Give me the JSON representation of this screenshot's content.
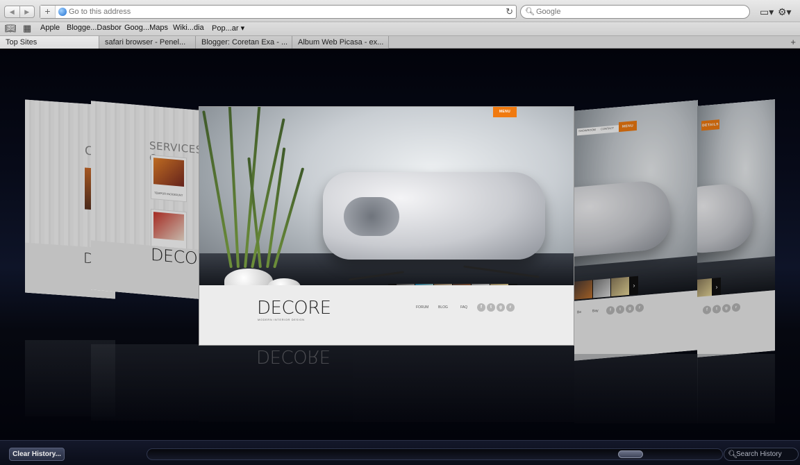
{
  "toolbar": {
    "back_icon": "back-arrow-icon",
    "forward_icon": "forward-arrow-icon",
    "address_placeholder": "Go to this address",
    "search_placeholder": "Google"
  },
  "bookmarks": {
    "items": [
      {
        "label": "Apple"
      },
      {
        "label": "Blogge...Dasbor"
      },
      {
        "label": "Goog...Maps"
      },
      {
        "label": "Wiki...dia"
      },
      {
        "label": "Pop...ar ▾"
      }
    ]
  },
  "tabs": [
    {
      "label": "Top Sites"
    },
    {
      "label": "safari browser - Penel..."
    },
    {
      "label": "Blogger: Coretan Exa - ..."
    },
    {
      "label": "Album Web Picasa - ex..."
    }
  ],
  "history": {
    "logo": "DECORE",
    "tagline": "MODERN INTERIOR DESIGN",
    "menu_label": "MENU",
    "nav": [
      "FORUM",
      "BLOG",
      "FAQ"
    ],
    "services_title": "SERVICES O",
    "service_caption": "TEMPOR INCIDIDUNT",
    "left_heading_letter": "C",
    "right_nav": [
      "Be",
      "Bay"
    ],
    "far_right_tab": "DETAILS",
    "right_tab_1": "SHOWROOM",
    "right_tab_2": "CONTACT",
    "right_tab_3": "MENU"
  },
  "bottom": {
    "clear_label": "Clear History...",
    "search_placeholder": "Search History"
  }
}
